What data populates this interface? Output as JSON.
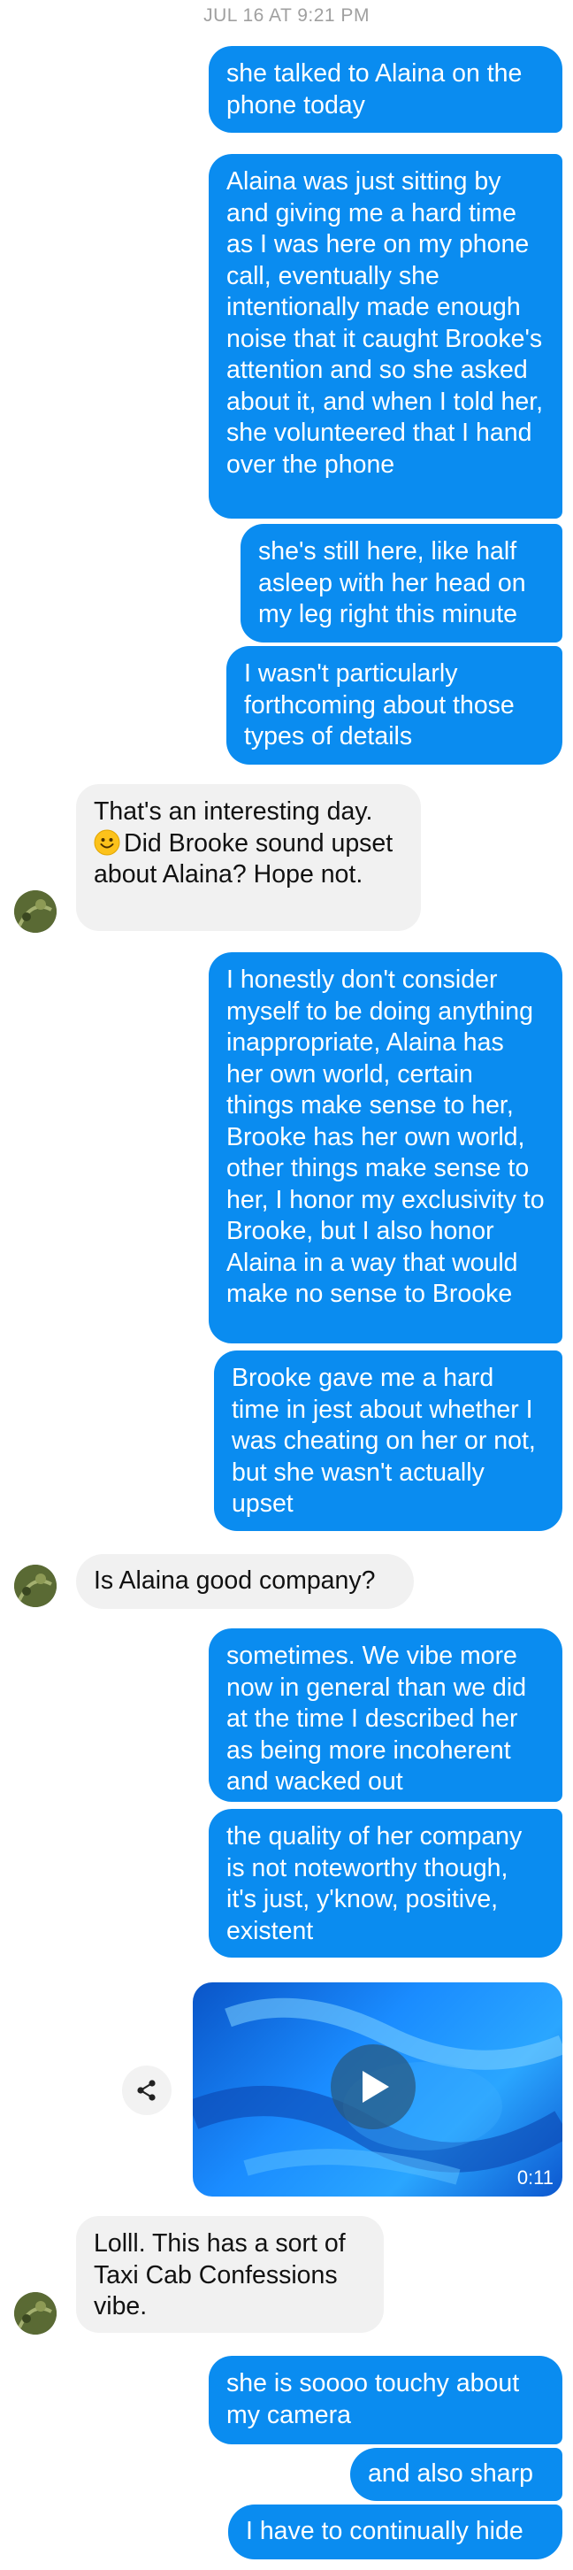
{
  "timestamp": "JUL 16 AT 9:21 PM",
  "messages": {
    "m1": "she talked to Alaina on the phone today",
    "m2": "Alaina was just sitting by and giving me a hard time as I was here on my phone call, eventually she intentionally made enough noise that it caught Brooke's attention and so she asked about it, and when I told her, she volunteered that I hand over the phone",
    "m3": "she's still here, like half asleep with her head on my leg right this minute",
    "m4": "I wasn't particularly forthcoming about those types of details",
    "r1_a": "That's an interesting day.",
    "r1_b": "Did Brooke sound upset about Alaina? Hope not.",
    "m5": "I honestly don't consider myself to be doing anything inappropriate, Alaina has her own world, certain things make sense to her, Brooke has her own world, other things make sense to her, I honor my exclusivity to Brooke, but I also honor Alaina in a way that would make no sense to Brooke",
    "m6": "Brooke gave me a hard time in jest about whether I was cheating on her or not, but she wasn't actually upset",
    "r2": "Is Alaina good company?",
    "m7": "sometimes. We vibe more now in general than we did at the time I described her as being more incoherent and wacked out",
    "m8": "the quality of her company is not noteworthy though, it's just, y'know, positive, existent",
    "video_duration": "0:11",
    "r3": "Lolll. This has a sort of Taxi Cab Confessions vibe.",
    "m9": "she is soooo touchy about my camera",
    "m10": "and also sharp",
    "m11": "I have to continually hide"
  },
  "colors": {
    "outgoing_bubble": "#0a8cf0",
    "incoming_bubble": "#f1f1f1",
    "timestamp_text": "#a0a0a0"
  },
  "icons": [
    "smile-emoji-icon",
    "play-icon",
    "share-icon",
    "avatar"
  ]
}
